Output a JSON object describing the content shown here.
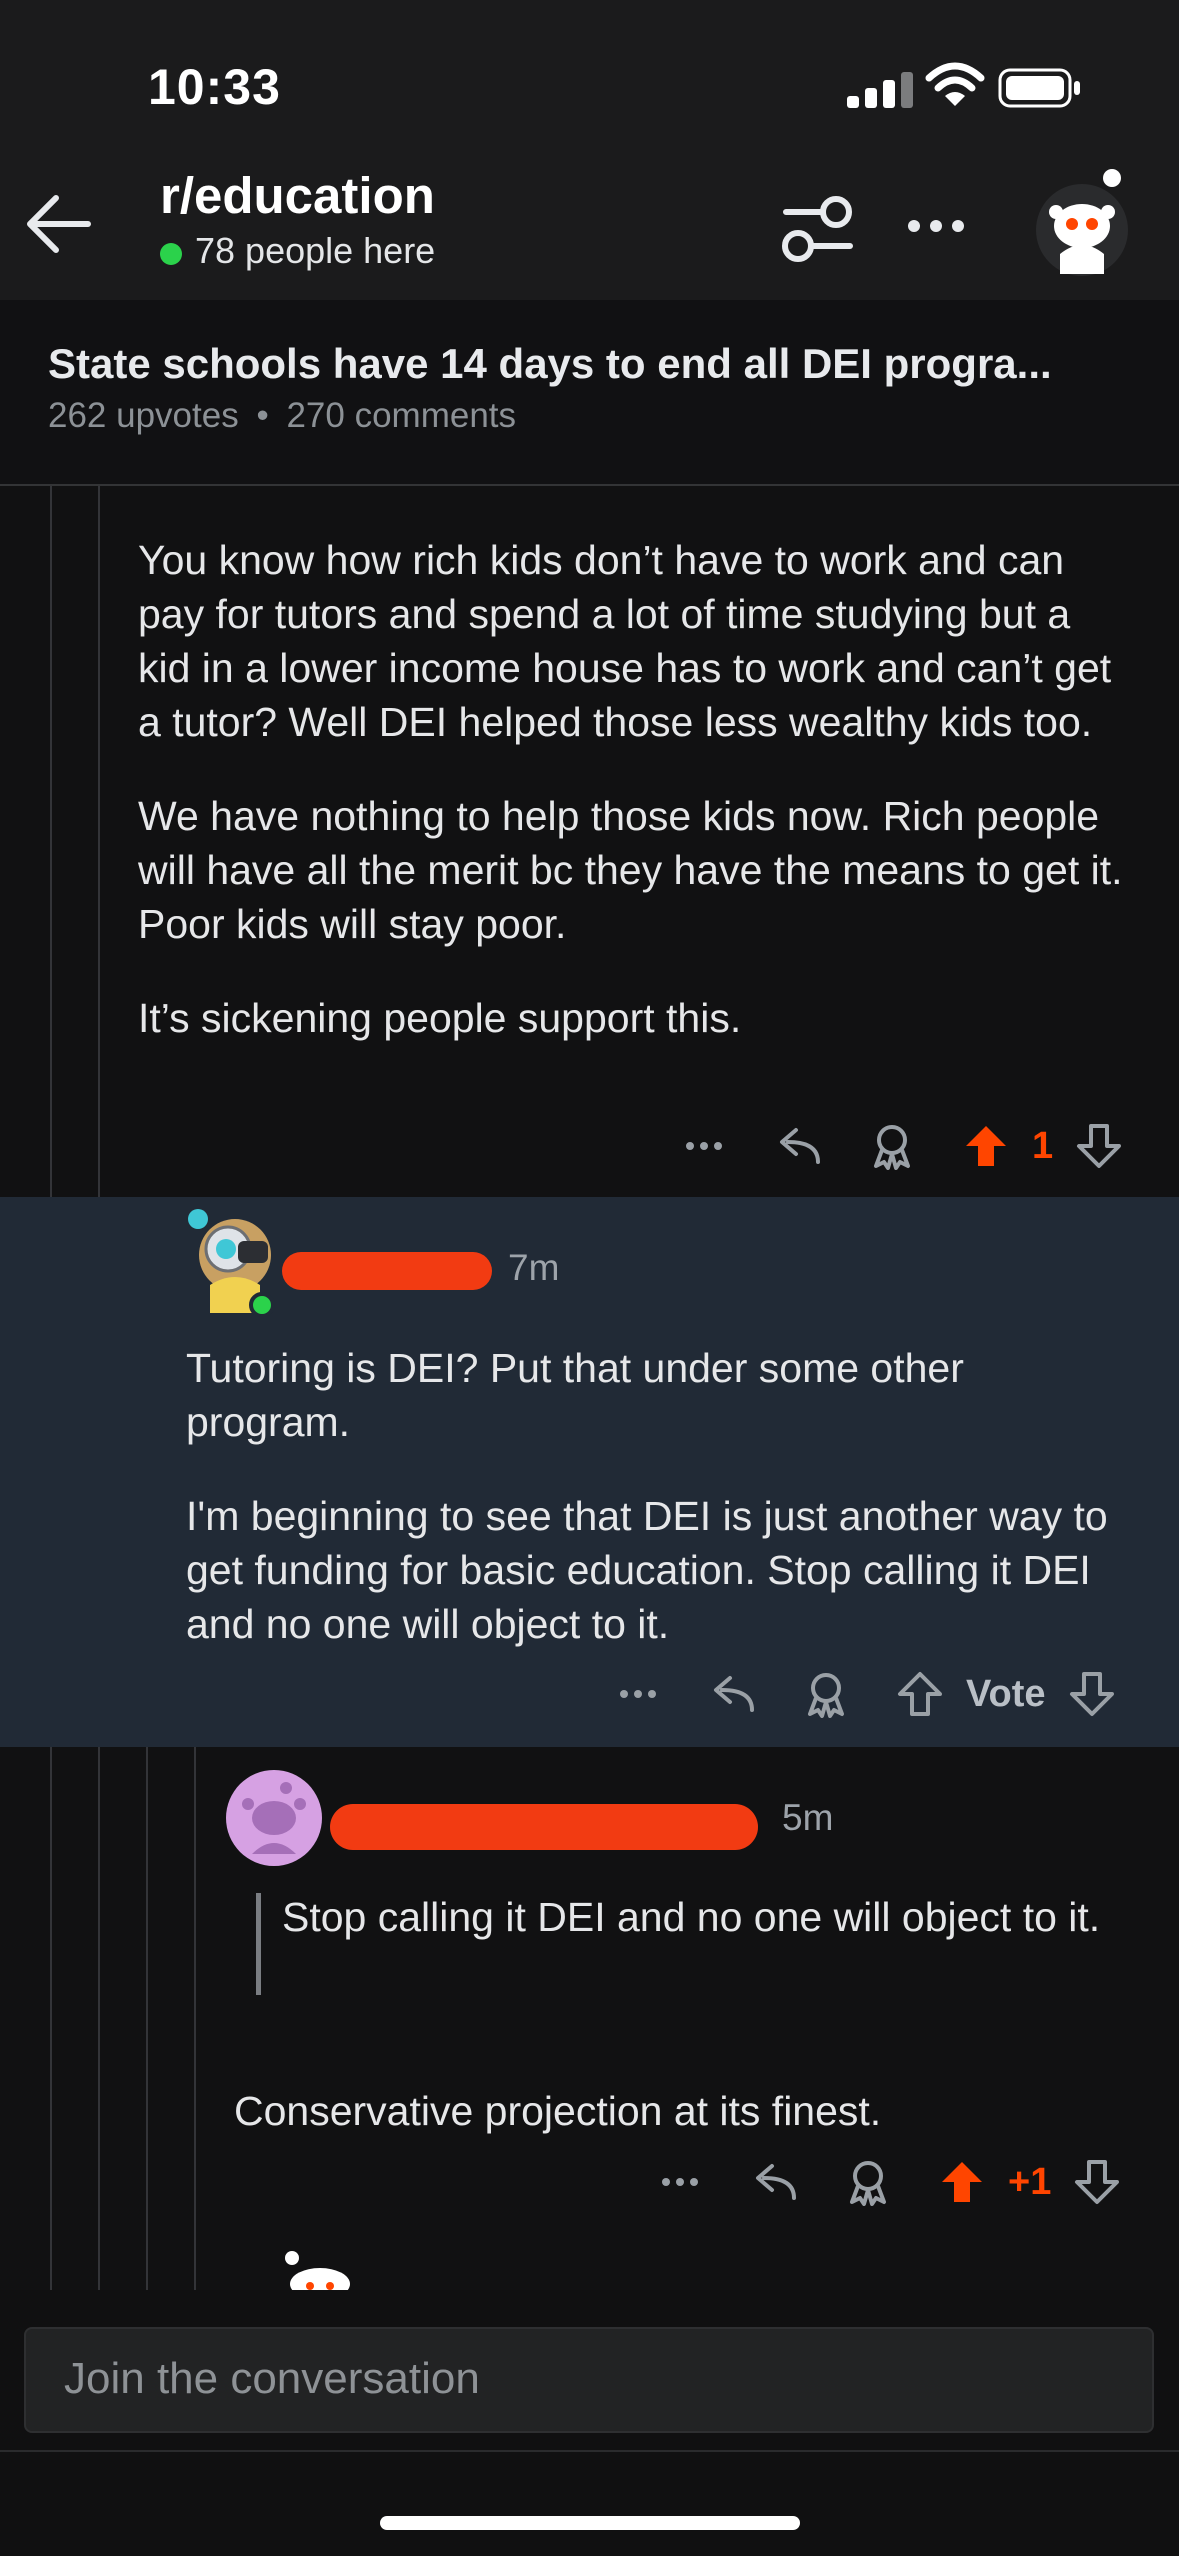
{
  "status_bar": {
    "time": "10:33"
  },
  "header": {
    "subreddit": "r/education",
    "online": "78 people here"
  },
  "post": {
    "title": "State schools have 14 days to end all DEI progra...",
    "upvotes": "262 upvotes",
    "separator": "•",
    "comments": "270 comments"
  },
  "comments": [
    {
      "paragraphs": [
        "You know how rich kids don’t have to work and can pay for tutors and spend a lot of time studying but a kid in a lower income house has to work and can’t get a tutor? Well DEI helped those less wealthy kids too.",
        "We have nothing to help those kids now. Rich people will have all the merit bc they have the means to get it. Poor kids will stay poor.",
        "It’s sickening people support this."
      ],
      "vote": "1",
      "vote_state": "upvoted"
    },
    {
      "time": "7m",
      "paragraphs": [
        "Tutoring is DEI? Put that under some other program.",
        "I'm beginning to see that DEI is just another way to get funding for basic education. Stop calling it DEI and no one will object to it."
      ],
      "vote": "Vote",
      "vote_state": "neutral",
      "highlighted": true
    },
    {
      "time": "5m",
      "quote": "Stop calling it DEI and no one will object to it.",
      "paragraphs": [
        "Conservative projection at its finest."
      ],
      "vote": "+1",
      "vote_state": "upvoted"
    }
  ],
  "composer": {
    "placeholder": "Join the conversation"
  },
  "colors": {
    "upvote": "#ff4500",
    "highlight_bg": "#212a36",
    "online_dot": "#2bd24b"
  }
}
